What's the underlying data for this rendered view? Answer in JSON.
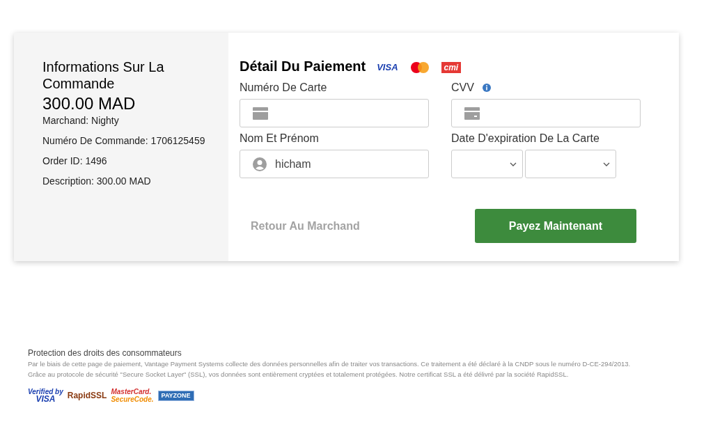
{
  "order": {
    "title": "Informations Sur La Commande",
    "amount": "300.00 MAD",
    "lines": [
      "Marchand: Nighty",
      "Numéro De Commande: 1706125459",
      "Order ID: 1496",
      "Description: 300.00 MAD"
    ]
  },
  "payment": {
    "title": "Détail Du Paiement",
    "card_logos": [
      {
        "kind": "visa",
        "text": "VISA"
      },
      {
        "kind": "mastercard"
      },
      {
        "kind": "cmi",
        "text": "cmi"
      }
    ],
    "card_number": {
      "label": "Numéro De Carte"
    },
    "cvv": {
      "label": "CVV"
    },
    "name": {
      "label": "Nom Et Prénom",
      "value": "hicham"
    },
    "expiry": {
      "label": "Date D'expiration De La Carte"
    },
    "back_link": "Retour Au Marchand",
    "pay_button": "Payez Maintenant"
  },
  "footer": {
    "title": "Protection des droits des consommateurs",
    "lines": [
      "Par le biais de cette page de paiement, Vantage Payment Systems collecte des données personnelles afin de traiter vos transactions. Ce traitement a été déclaré à la CNDP sous le numéro D-CE-294/2013.",
      "Grâce au protocole de sécurité \"Secure Socket Layer\" (SSL), vos données sont entièrement cryptées et totalement protégées. Notre certificat SSL a été délivré par la société RapidSSL."
    ],
    "badges": [
      {
        "kind": "verified",
        "lines": [
          "Verified by",
          "VISA"
        ]
      },
      {
        "kind": "rapidssl",
        "lines": [
          "RapidSSL"
        ]
      },
      {
        "kind": "securecode",
        "lines": [
          "MasterCard.",
          "SecureCode."
        ]
      },
      {
        "kind": "payzone",
        "lines": [
          "PAYZONE"
        ]
      }
    ]
  }
}
